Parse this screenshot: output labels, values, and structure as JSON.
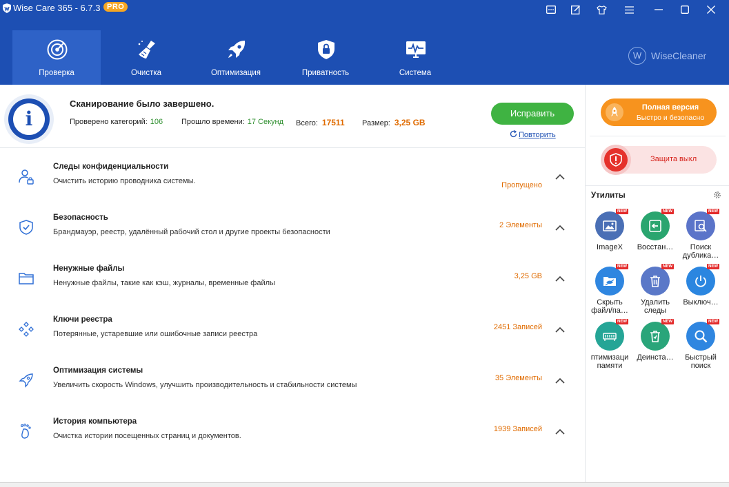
{
  "window": {
    "title": "Wise Care 365 - 6.7.3",
    "badge": "PRO"
  },
  "nav": {
    "tabs": [
      {
        "label": "Проверка",
        "icon": "radar-icon",
        "active": true
      },
      {
        "label": "Очистка",
        "icon": "broom-icon",
        "active": false
      },
      {
        "label": "Оптимизация",
        "icon": "rocket-icon",
        "active": false
      },
      {
        "label": "Приватность",
        "icon": "privacy-shield-icon",
        "active": false
      },
      {
        "label": "Система",
        "icon": "monitor-icon",
        "active": false
      }
    ],
    "brand": "WiseCleaner",
    "brand_letter": "W"
  },
  "summary": {
    "title": "Сканирование было завершено.",
    "checked_label": "Проверено категорий:",
    "checked_value": "106",
    "time_label": "Прошло времени:",
    "time_value": "17 Секунд",
    "total_label": "Всего:",
    "total_value": "17511",
    "size_label": "Размер:",
    "size_value": "3,25 GB",
    "fix_button": "Исправить",
    "retry_link": "Повторить"
  },
  "categories": [
    {
      "title": "Следы конфиденциальности",
      "description": "Очистить историю проводника системы.",
      "status": "Пропущено",
      "icon": "user-lock-icon"
    },
    {
      "title": "Безопасность",
      "description": "Брандмауэр, реестр, удалённый рабочий стол и другие проекты безопасности",
      "status": "2 Элементы",
      "icon": "shield-check-icon"
    },
    {
      "title": "Ненужные файлы",
      "description": "Ненужные файлы, такие как кэш, журналы, временные файлы",
      "status": "3,25 GB",
      "icon": "folder-icon"
    },
    {
      "title": "Ключи реестра",
      "description": "Потерянные, устаревшие или ошибочные записи реестра",
      "status": "2451 Записей",
      "icon": "registry-diamonds-icon"
    },
    {
      "title": "Оптимизация системы",
      "description": "Увеличить скорость Windows, улучшить производительность и стабильности системы",
      "status": "35 Элементы",
      "icon": "rocket-outline-icon"
    },
    {
      "title": "История компьютера",
      "description": "Очистка истории посещенных страниц и документов.",
      "status": "1939 Записей",
      "icon": "footprint-icon"
    }
  ],
  "right_panel": {
    "full_version_title": "Полная версия",
    "full_version_sub": "Быстро и безопасно",
    "protection_label": "Защита выкл",
    "utilities_title": "Утилиты",
    "new_badge": "NEW",
    "tools": [
      {
        "label": "ImageX",
        "color": "#4a6fb5"
      },
      {
        "label": "Восстан…",
        "color": "#2aa56f"
      },
      {
        "label": "Поиск дублика…",
        "color": "#5b74c9"
      },
      {
        "label": "Скрыть файл/па…",
        "color": "#2f86e0"
      },
      {
        "label": "Удалить следы",
        "color": "#5a78c8"
      },
      {
        "label": "Выключ…",
        "color": "#2b86e0"
      },
      {
        "label": "птимизаци памяти",
        "color": "#25a596"
      },
      {
        "label": "Деинста…",
        "color": "#2aa57a"
      },
      {
        "label": "Быстрый поиск",
        "color": "#2f86e0"
      }
    ]
  }
}
